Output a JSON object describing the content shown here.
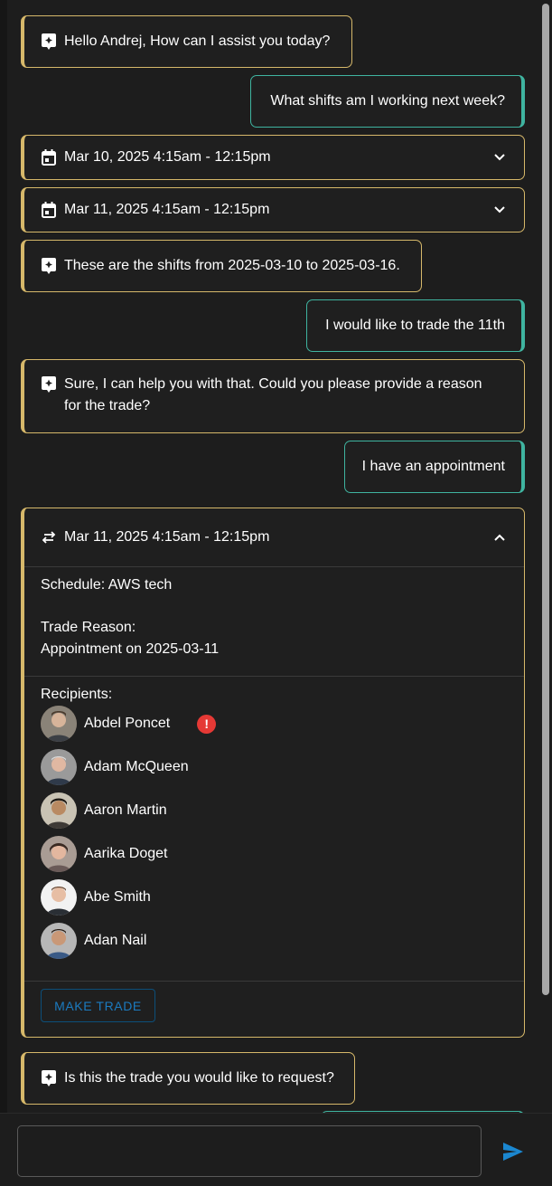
{
  "messages": [
    {
      "text": "Hello Andrej, How can I assist you today?"
    },
    {
      "text": "What shifts am I working next week?"
    },
    {
      "shift": "Mar 10, 2025 4:15am - 12:15pm"
    },
    {
      "shift": "Mar 11, 2025 4:15am - 12:15pm"
    },
    {
      "text": "These are the shifts from 2025-03-10 to 2025-03-16."
    },
    {
      "text": "I would like to trade the 11th"
    },
    {
      "line1": "Sure, I can help you with that. Could you please provide a reason",
      "line2": "for the trade?"
    },
    {
      "text": "I have an appointment"
    },
    {
      "text": "Is this the trade you would like to request?"
    }
  ],
  "trade_card": {
    "title": "Mar 11, 2025 4:15am - 12:15pm",
    "schedule": "Schedule: AWS tech",
    "reason_label": "Trade Reason:",
    "reason_value": "Appointment on 2025-03-11",
    "recipients_label": "Recipients:",
    "recipients": [
      {
        "name": "Abdel Poncet",
        "warning": "!"
      },
      {
        "name": "Adam McQueen"
      },
      {
        "name": "Aaron Martin"
      },
      {
        "name": "Aarika Doget"
      },
      {
        "name": "Abe Smith"
      },
      {
        "name": "Adan Nail"
      }
    ],
    "button_label": "MAKE TRADE"
  },
  "composer": {
    "placeholder": ""
  },
  "colors": {
    "bot_accent": "#d6b86a",
    "user_accent": "#3fb4a0",
    "button_text": "#1b7bc0",
    "warning": "#e53935"
  }
}
